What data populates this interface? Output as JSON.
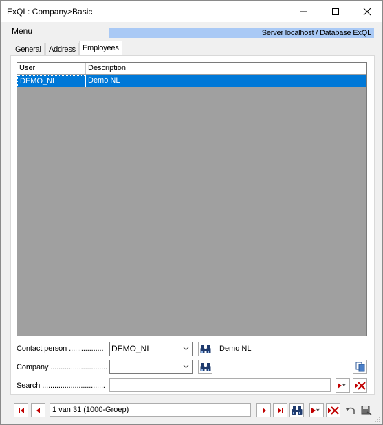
{
  "window": {
    "title": "ExQL: Company>Basic",
    "controls": {
      "minimize": "minimize-icon",
      "maximize": "maximize-icon",
      "close": "close-icon"
    }
  },
  "menu": {
    "label": "Menu"
  },
  "server_info": "Server localhost / Database ExQL",
  "tabs": [
    {
      "label": "General",
      "active": false
    },
    {
      "label": "Address",
      "active": false
    },
    {
      "label": "Employees",
      "active": true
    }
  ],
  "grid": {
    "columns": [
      "User",
      "Description"
    ],
    "rows": [
      {
        "user": "DEMO_NL",
        "description": "Demo NL",
        "selected": true
      }
    ]
  },
  "form": {
    "contact_person": {
      "label": "Contact person .................",
      "value": "DEMO_NL",
      "description": "Demo NL"
    },
    "company": {
      "label": "Company ............................",
      "value": ""
    },
    "search": {
      "label": "Search ...............................",
      "value": ""
    }
  },
  "navigation": {
    "record_text": "1 van 31 (1000-Groep)"
  },
  "colors": {
    "selection": "#0078d7",
    "server_bar": "#a9c9f5",
    "grid_background": "#a0a0a0",
    "nav_red": "#c00000"
  }
}
